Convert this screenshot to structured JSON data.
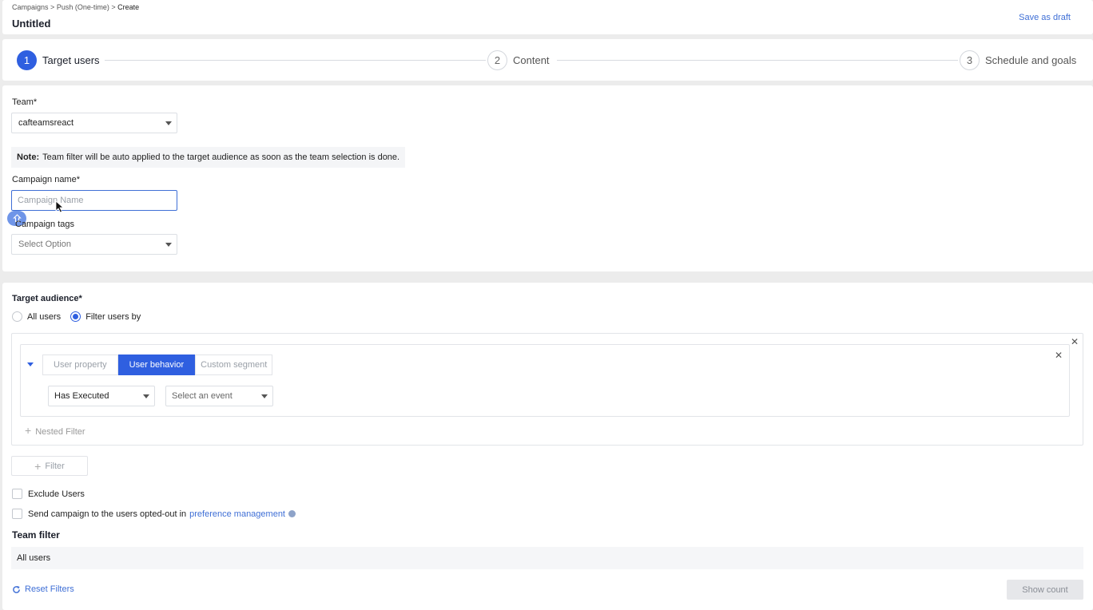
{
  "header": {
    "breadcrumb": [
      "Campaigns",
      "Push (One-time)",
      "Create"
    ],
    "breadcrumb_separator": ">",
    "title": "Untitled",
    "save_draft_label": "Save as draft"
  },
  "stepper": {
    "steps": [
      {
        "number": "1",
        "label": "Target users",
        "active": true
      },
      {
        "number": "2",
        "label": "Content",
        "active": false
      },
      {
        "number": "3",
        "label": "Schedule and goals",
        "active": false
      }
    ]
  },
  "form": {
    "team_label": "Team*",
    "team_value": "cafteamsreact",
    "note_bold": "Note:",
    "note_text": "Team filter will be auto applied to the target audience as soon as the team selection is done.",
    "campaign_name_label": "Campaign name*",
    "campaign_name_placeholder": "Campaign Name",
    "campaign_name_value": "",
    "tags_label": "Campaign tags",
    "tags_placeholder": "Select Option"
  },
  "audience": {
    "title": "Target audience*",
    "options": [
      "All users",
      "Filter users by"
    ],
    "selected_option": "Filter users by",
    "filter_tabs": [
      "User property",
      "User behavior",
      "Custom segment"
    ],
    "active_tab": "User behavior",
    "behavior_select_value": "Has Executed",
    "event_select_placeholder": "Select an event",
    "nested_filter_label": "Nested Filter",
    "add_filter_label": "Filter",
    "exclude_users_label": "Exclude Users",
    "opted_out_text": "Send campaign to the users opted-out in",
    "opted_out_link": "preference management",
    "team_filter_title": "Team filter",
    "team_filter_value": "All users",
    "reset_label": "Reset Filters",
    "show_count_label": "Show count"
  },
  "colors": {
    "accent": "#2f5fe0",
    "link": "#3f6fd6",
    "background": "#ececec"
  },
  "icons": {
    "close": "close-icon",
    "reset": "refresh-icon",
    "info": "info-icon",
    "help": "help-bubble-icon"
  }
}
